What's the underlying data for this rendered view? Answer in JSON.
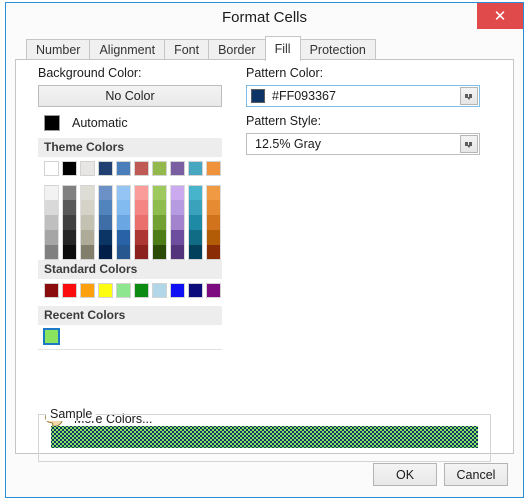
{
  "window": {
    "title": "Format Cells",
    "close_icon": "close-icon",
    "accent": "#2a8fd4",
    "close_bg": "#e04a4a"
  },
  "tabs": [
    {
      "label": "Number",
      "selected": false
    },
    {
      "label": "Alignment",
      "selected": false
    },
    {
      "label": "Font",
      "selected": false
    },
    {
      "label": "Border",
      "selected": false
    },
    {
      "label": "Fill",
      "selected": true
    },
    {
      "label": "Protection",
      "selected": false
    }
  ],
  "fill": {
    "background_label": "Background Color:",
    "no_color_label": "No Color",
    "automatic_label": "Automatic",
    "automatic_color": "#000000",
    "theme_colors_label": "Theme Colors",
    "standard_colors_label": "Standard Colors",
    "recent_colors_label": "Recent Colors",
    "more_colors_label": "More Colors...",
    "more_colors_icon": "palette-icon",
    "theme_base": [
      "#ffffff",
      "#000000",
      "#e7e6e4",
      "#1f4070",
      "#4a7ebb",
      "#bf5a54",
      "#93b84c",
      "#7a5ea2",
      "#47a7c0",
      "#f0923c"
    ],
    "theme_variants": [
      [
        "#f2f2f2",
        "#d9d9d9",
        "#bfbfbf",
        "#a6a6a6",
        "#808080"
      ],
      [
        "#808080",
        "#595959",
        "#404040",
        "#262626",
        "#0d0d0d"
      ],
      [
        "#ddddd6",
        "#d5d3c8",
        "#c3c1b2",
        "#aeac99",
        "#817f6c"
      ],
      [
        "#6b91c6",
        "#5183bd",
        "#3f6da6",
        "#0b3564",
        "#021f4a"
      ],
      [
        "#93c4f4",
        "#82bbf0",
        "#6aa6e2",
        "#2a62a8",
        "#27578f"
      ],
      [
        "#fa9d9a",
        "#f58582",
        "#e9706c",
        "#ad3833",
        "#8d211d"
      ],
      [
        "#9ec95e",
        "#8fbd4d",
        "#73a033",
        "#4e7d17",
        "#2c4c05"
      ],
      [
        "#cbaaf0",
        "#b79be0",
        "#a383cd",
        "#6d4e9e",
        "#53337c"
      ],
      [
        "#47b4cb",
        "#3ba2bb",
        "#1f8aa6",
        "#106b85",
        "#02405c"
      ],
      [
        "#f09a43",
        "#e78b33",
        "#d1721c",
        "#b35c07",
        "#8a2c05"
      ]
    ],
    "standard_colors": [
      "#8b0c0c",
      "#fc0d0d",
      "#fca00d",
      "#fdfd12",
      "#8ee78e",
      "#0b8b11",
      "#b1d7e8",
      "#1010f5",
      "#0c0c7d",
      "#7d0c80"
    ],
    "recent_colors": [
      "#8ae45e"
    ],
    "recent_selected_index": 0,
    "pattern_color_label": "Pattern Color:",
    "pattern_color_value": "#FF093367",
    "pattern_color_swatch": "#0d3367",
    "pattern_style_label": "Pattern Style:",
    "pattern_style_value": "12.5% Gray",
    "sample_label": "Sample",
    "sample_background": "#8ae45e",
    "sample_pattern_color": "#0d3367"
  },
  "footer": {
    "ok_label": "OK",
    "cancel_label": "Cancel"
  }
}
